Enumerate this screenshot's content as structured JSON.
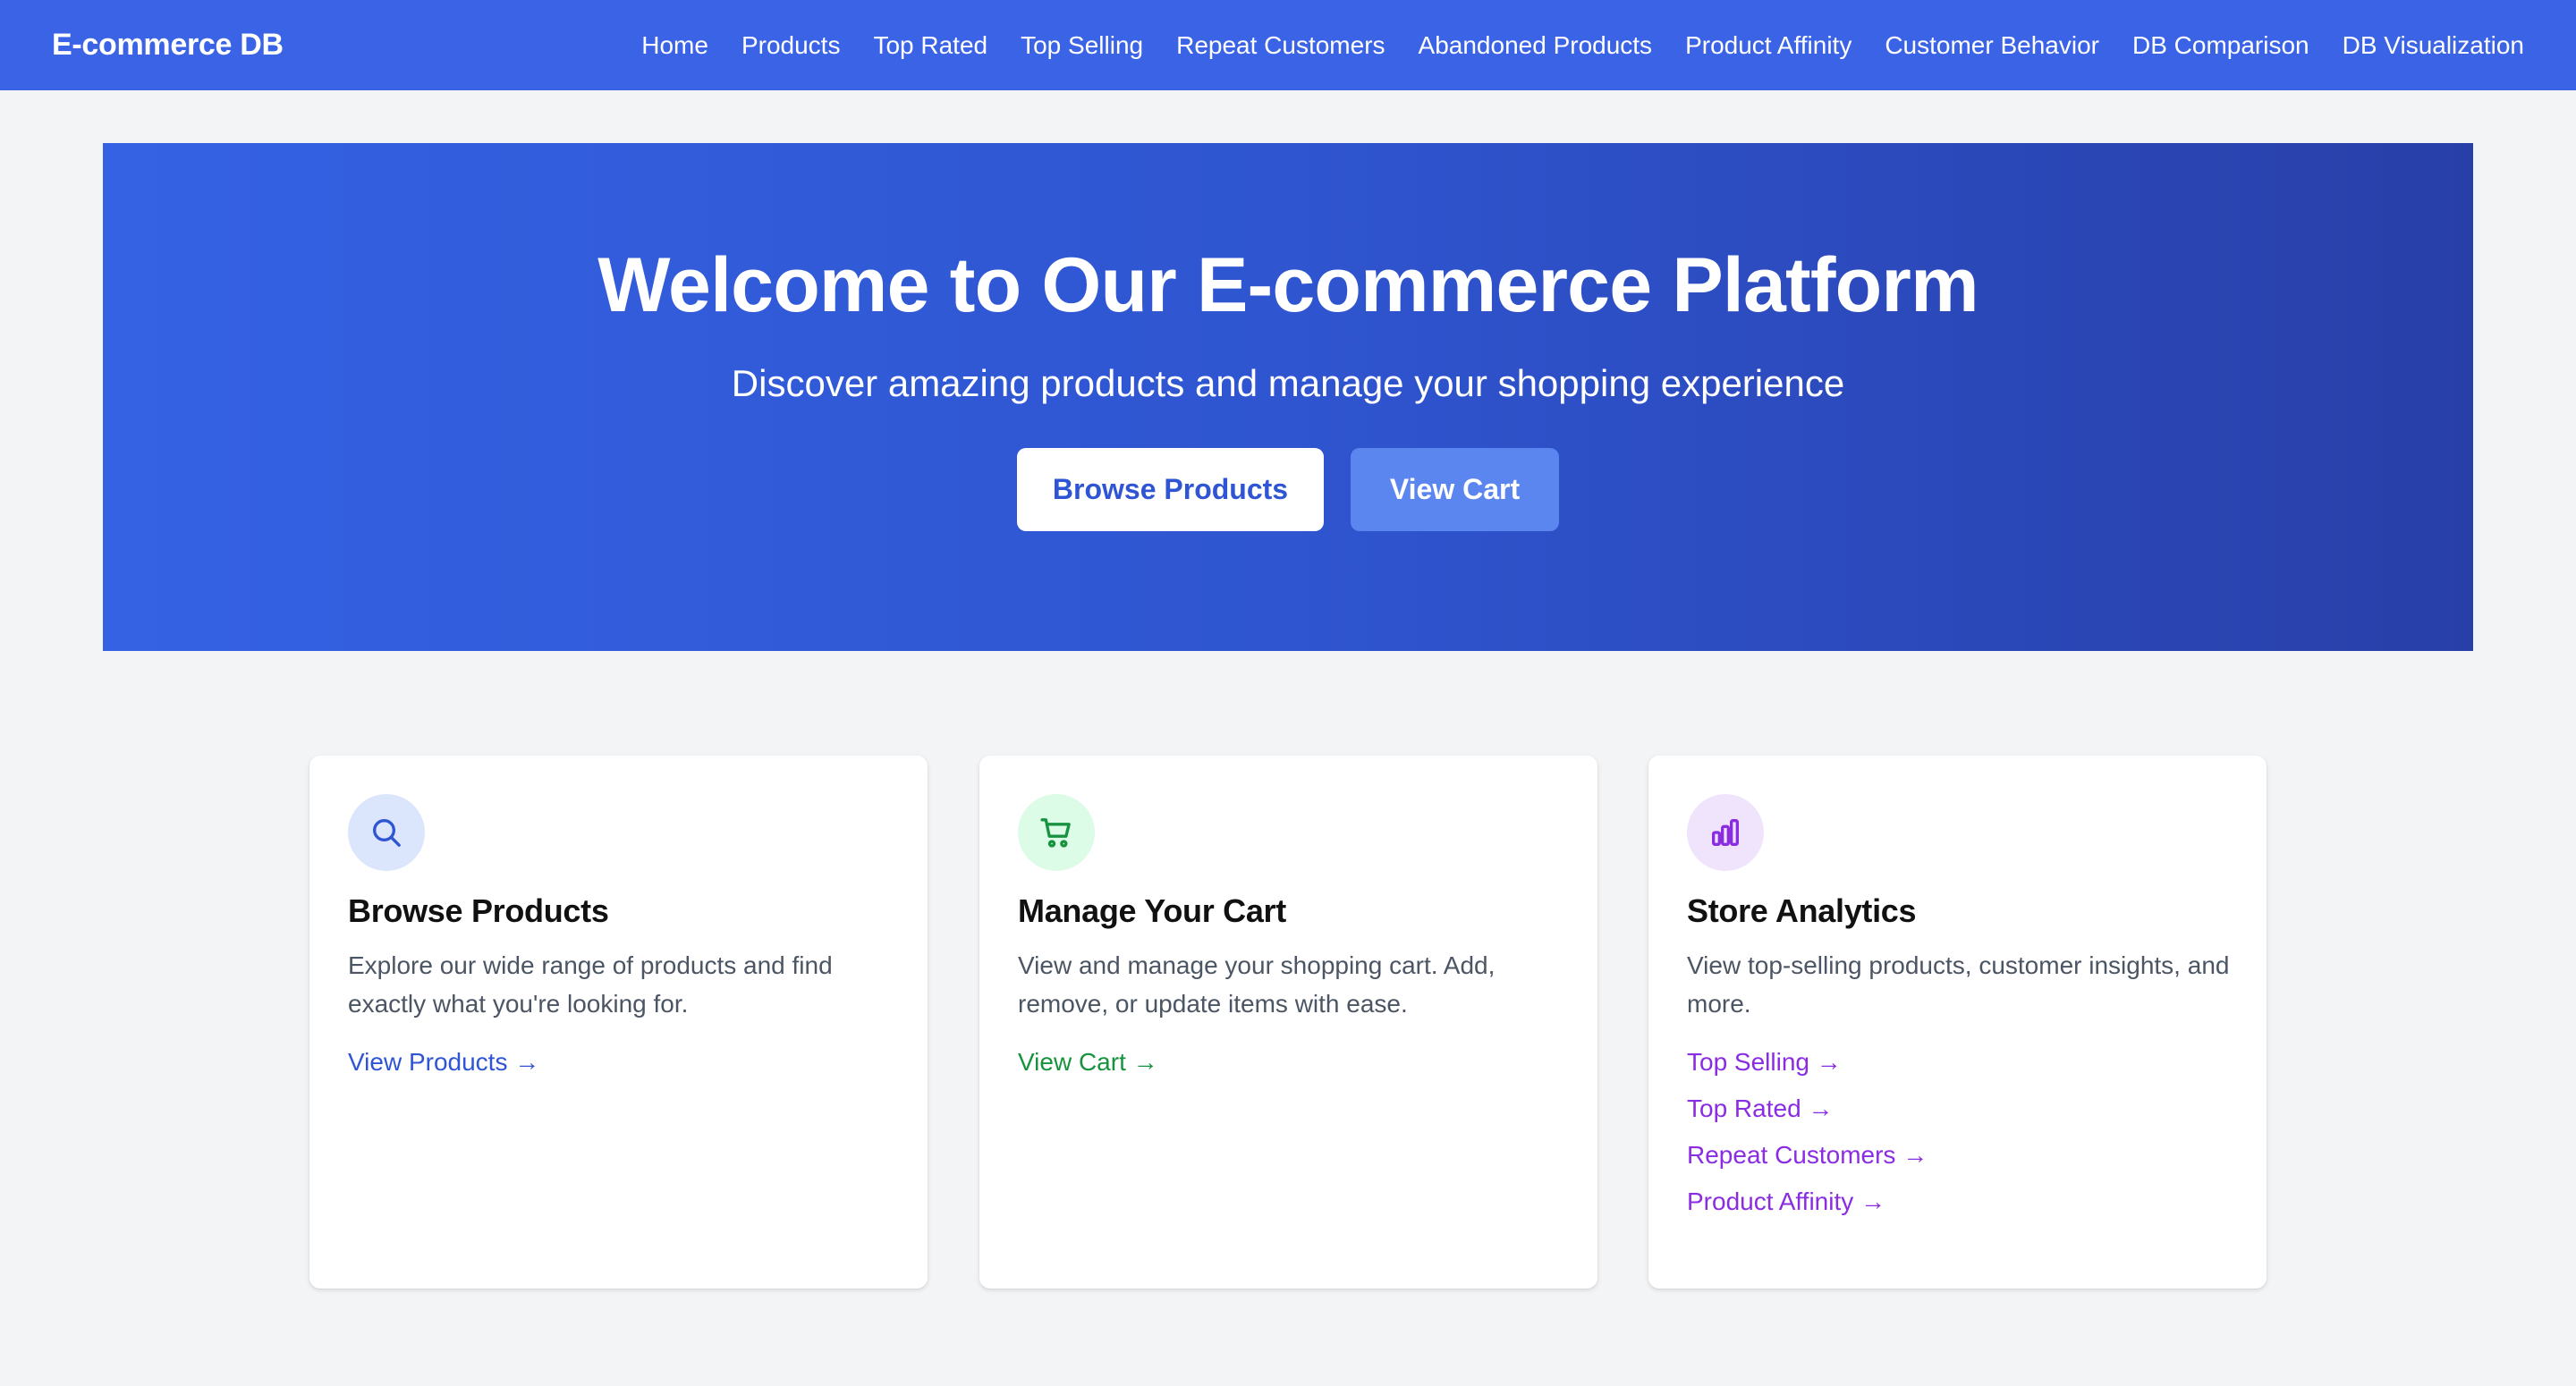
{
  "navbar": {
    "brand": "E-commerce DB",
    "links": [
      "Home",
      "Products",
      "Top Rated",
      "Top Selling",
      "Repeat Customers",
      "Abandoned Products",
      "Product Affinity",
      "Customer Behavior",
      "DB Comparison",
      "DB Visualization"
    ]
  },
  "hero": {
    "title": "Welcome to Our E-commerce Platform",
    "subtitle": "Discover amazing products and manage your shopping experience",
    "primary_button": "Browse Products",
    "secondary_button": "View Cart"
  },
  "cards": [
    {
      "icon": "search-icon",
      "title": "Browse Products",
      "description": "Explore our wide range of products and find exactly what you're looking for.",
      "links": [
        "View Products →"
      ]
    },
    {
      "icon": "cart-icon",
      "title": "Manage Your Cart",
      "description": "View and manage your shopping cart. Add, remove, or update items with ease.",
      "links": [
        "View Cart →"
      ]
    },
    {
      "icon": "bar-chart-icon",
      "title": "Store Analytics",
      "description": "View top-selling products, customer insights, and more.",
      "links": [
        "Top Selling →",
        "Top Rated →",
        "Repeat Customers →",
        "Product Affinity →"
      ]
    }
  ],
  "colors": {
    "navbar_bg": "#3b63e6",
    "accent_blue": "#2f55d4",
    "accent_green": "#17923f",
    "accent_purple": "#8a2ce2",
    "page_bg": "#f3f4f6"
  }
}
